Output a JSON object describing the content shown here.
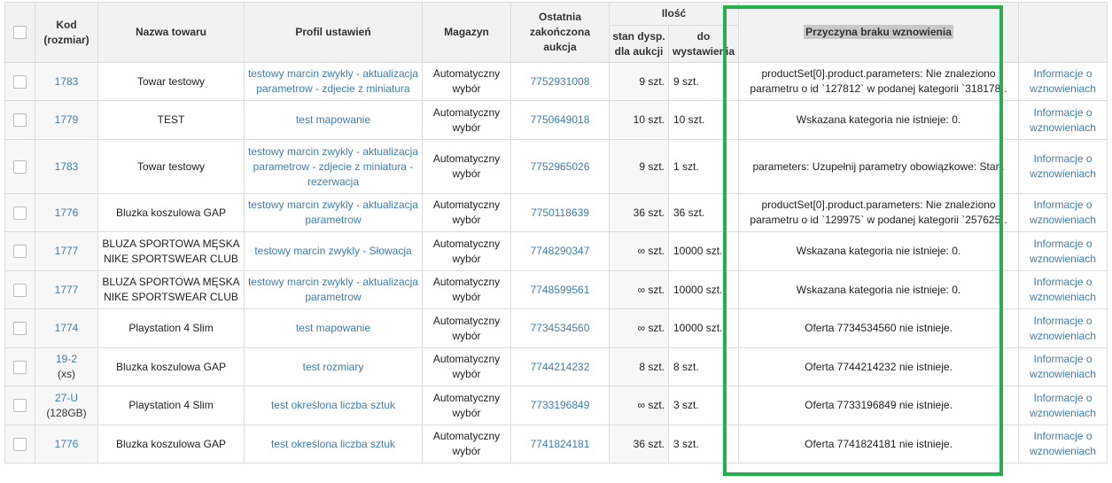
{
  "header": {
    "code": "Kod",
    "code_sub": "(rozmiar)",
    "name": "Nazwa towaru",
    "profile": "Profil ustawień",
    "warehouse": "Magazyn",
    "last_auction_l1": "Ostatnia",
    "last_auction_l2": "zakończona",
    "last_auction_l3": "aukcja",
    "qty": "Ilość",
    "qty_avail_l1": "stan dysp.",
    "qty_avail_l2": "dla aukcji",
    "qty_post_l1": "do",
    "qty_post_l2": "wystawienia",
    "reason": "Przyczyna braku wznowienia"
  },
  "rows": [
    {
      "code": "1783",
      "size": "",
      "name": "Towar testowy",
      "profile": "testowy marcin zwykly - aktualizacja parametrow - zdjecie z miniatura",
      "warehouse": "Automatyczny wybór",
      "auction": "7752931008",
      "avail": "9 szt.",
      "post": "9 szt.",
      "reason": "productSet[0].product.parameters: Nie znaleziono parametru o id `127812` w podanej kategorii `318178`.",
      "info": "Informacje o wznowieniach"
    },
    {
      "code": "1779",
      "size": "",
      "name": "TEST",
      "profile": "test mapowanie",
      "warehouse": "Automatyczny wybór",
      "auction": "7750649018",
      "avail": "10 szt.",
      "post": "10 szt.",
      "reason": "Wskazana kategoria nie istnieje: 0.",
      "info": "Informacje o wznowieniach"
    },
    {
      "code": "1783",
      "size": "",
      "name": "Towar testowy",
      "profile": "testowy marcin zwykly - aktualizacja parametrow - zdjecie z miniatura - rezerwacja",
      "warehouse": "Automatyczny wybór",
      "auction": "7752965026",
      "avail": "9 szt.",
      "post": "1 szt.",
      "reason": "parameters: Uzupełnij parametry obowiązkowe: Stan.",
      "info": "Informacje o wznowieniach"
    },
    {
      "code": "1776",
      "size": "",
      "name": "Bluzka koszulowa GAP",
      "profile": "testowy marcin zwykly - aktualizacja parametrow",
      "warehouse": "Automatyczny wybór",
      "auction": "7750118639",
      "avail": "36 szt.",
      "post": "36 szt.",
      "reason": "productSet[0].product.parameters: Nie znaleziono parametru o id `129975` w podanej kategorii `257625`.",
      "info": "Informacje o wznowieniach"
    },
    {
      "code": "1777",
      "size": "",
      "name": "BLUZA SPORTOWA MĘSKA NIKE SPORTSWEAR CLUB",
      "profile": "testowy marcin zwykly - Słowacja",
      "warehouse": "Automatyczny wybór",
      "auction": "7748290347",
      "avail": "∞ szt.",
      "post": "10000 szt.",
      "reason": "Wskazana kategoria nie istnieje: 0.",
      "info": "Informacje o wznowieniach"
    },
    {
      "code": "1777",
      "size": "",
      "name": "BLUZA SPORTOWA MĘSKA NIKE SPORTSWEAR CLUB",
      "profile": "testowy marcin zwykly - aktualizacja parametrow",
      "warehouse": "Automatyczny wybór",
      "auction": "7748599561",
      "avail": "∞ szt.",
      "post": "10000 szt.",
      "reason": "Wskazana kategoria nie istnieje: 0.",
      "info": "Informacje o wznowieniach"
    },
    {
      "code": "1774",
      "size": "",
      "name": "Playstation 4 Slim",
      "profile": "test mapowanie",
      "warehouse": "Automatyczny wybór",
      "auction": "7734534560",
      "avail": "∞ szt.",
      "post": "10000 szt.",
      "reason": "Oferta 7734534560 nie istnieje.",
      "info": "Informacje o wznowieniach"
    },
    {
      "code": "19-2",
      "size": "(xs)",
      "name": "Bluzka koszulowa GAP",
      "profile": "test rozmiary",
      "warehouse": "Automatyczny wybór",
      "auction": "7744214232",
      "avail": "8 szt.",
      "post": "8 szt.",
      "reason": "Oferta 7744214232 nie istnieje.",
      "info": "Informacje o wznowieniach"
    },
    {
      "code": "27-U",
      "size": "(128GB)",
      "name": "Playstation 4 Slim",
      "profile": "test określona liczba sztuk",
      "warehouse": "Automatyczny wybór",
      "auction": "7733196849",
      "avail": "∞ szt.",
      "post": "3 szt.",
      "reason": "Oferta 7733196849 nie istnieje.",
      "info": "Informacje o wznowieniach"
    },
    {
      "code": "1776",
      "size": "",
      "name": "Bluzka koszulowa GAP",
      "profile": "test określona liczba sztuk",
      "warehouse": "Automatyczny wybór",
      "auction": "7741824181",
      "avail": "36 szt.",
      "post": "3 szt.",
      "reason": "Oferta 7741824181 nie istnieje.",
      "info": "Informacje o wznowieniach"
    }
  ],
  "colors": {
    "link": "#3d7fb8",
    "highlight_box": "#22b14c",
    "header_bg": "#f2f2f2"
  }
}
